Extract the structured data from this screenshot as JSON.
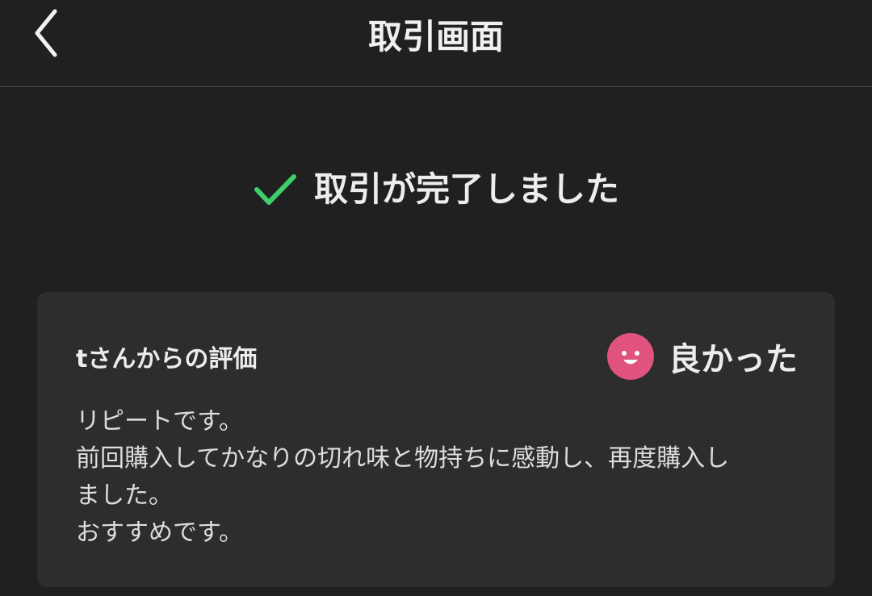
{
  "header": {
    "title": "取引画面",
    "back_icon": "chevron-left-icon"
  },
  "status": {
    "icon": "checkmark-icon",
    "icon_color": "#3ecf6a",
    "text": "取引が完了しました"
  },
  "review": {
    "reviewer_label": "tさんからの評価",
    "rating_icon": "smile-face-icon",
    "rating_icon_color": "#e0537e",
    "rating_label": "良かった",
    "comment_lines": [
      "リピートです。",
      "前回購入してかなりの切れ味と物持ちに感動し、再度購入し",
      "ました。",
      "おすすめです。"
    ]
  }
}
